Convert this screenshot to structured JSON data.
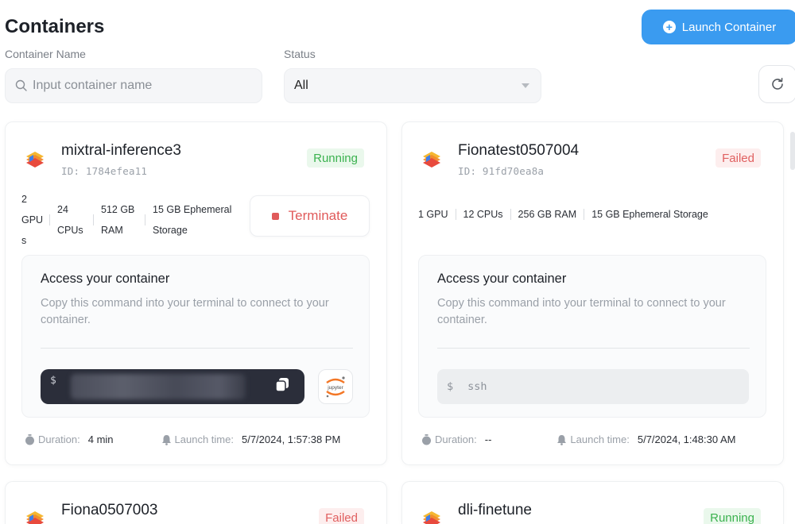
{
  "header": {
    "title": "Containers",
    "launch_label": "Launch Container"
  },
  "filters": {
    "name_label": "Container Name",
    "name_placeholder": "Input container name",
    "status_label": "Status",
    "status_value": "All"
  },
  "colors": {
    "accent": "#3a9bf0",
    "running": "#3bb24f",
    "failed": "#e06060",
    "terminate": "#e05a5a"
  },
  "cards": [
    {
      "name": "mixtral-inference3",
      "id": "ID: 1784efea11",
      "status": "Running",
      "specs": [
        "2 GPU s",
        "24 CPUs",
        "512 GB RAM",
        "15 GB Ephemeral Storage"
      ],
      "terminate_label": "Terminate",
      "access_title": "Access your container",
      "access_desc": "Copy this command into your terminal to connect to your container.",
      "cmd_prefix": "$",
      "duration_label": "Duration:",
      "duration": "4 min",
      "launch_label": "Launch time:",
      "launch_time": "5/7/2024, 1:57:38 PM",
      "jupyter_label": "jupyter"
    },
    {
      "name": "Fionatest0507004",
      "id": "ID: 91fd70ea8a",
      "status": "Failed",
      "specs": [
        "1 GPU",
        "12 CPUs",
        "256 GB RAM",
        "15 GB Ephemeral Storage"
      ],
      "access_title": "Access your container",
      "access_desc": "Copy this command into your terminal to connect to your container.",
      "cmd_prefix": "$",
      "cmd": "ssh",
      "duration_label": "Duration:",
      "duration": "--",
      "launch_label": "Launch time:",
      "launch_time": "5/7/2024, 1:48:30 AM"
    },
    {
      "name": "Fiona0507003",
      "status": "Failed"
    },
    {
      "name": "dli-finetune",
      "status": "Running"
    }
  ]
}
